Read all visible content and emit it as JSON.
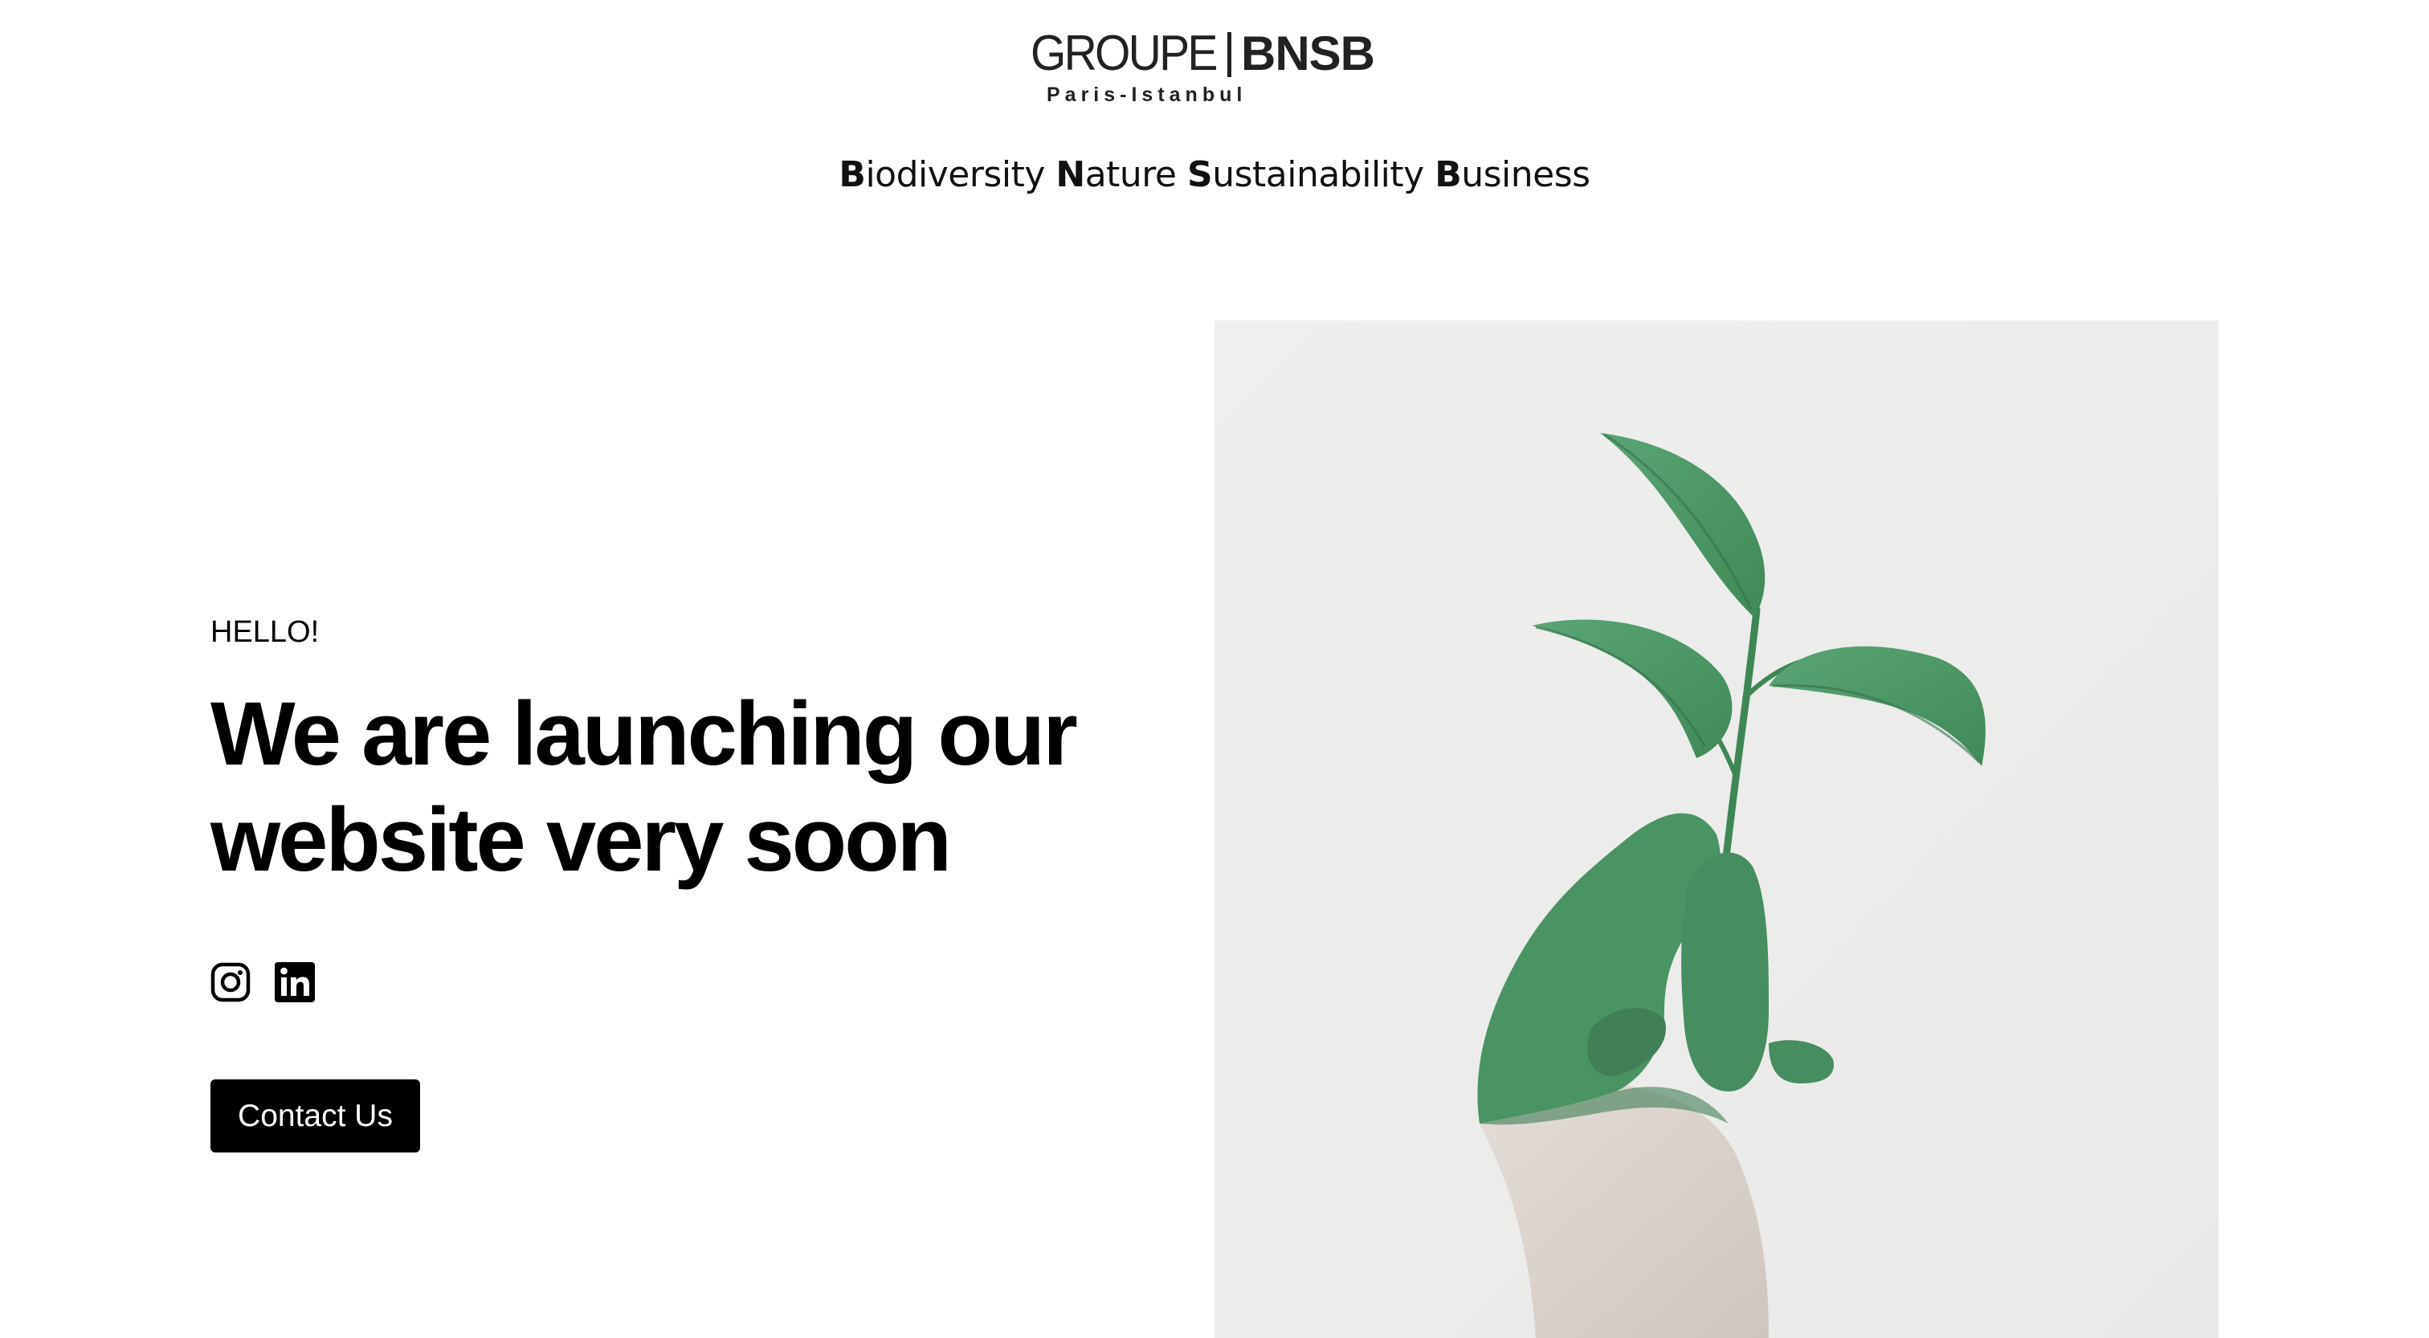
{
  "header": {
    "logo_light": "GROUPE",
    "logo_bold": "BNSB",
    "logo_sub": "Paris-Istanbul",
    "tagline": [
      {
        "initial": "B",
        "rest": "iodiversity"
      },
      {
        "initial": "N",
        "rest": "ature"
      },
      {
        "initial": "S",
        "rest": "ustainability"
      },
      {
        "initial": "B",
        "rest": "usiness"
      }
    ]
  },
  "main": {
    "greeting": "HELLO!",
    "headline_line1": "We are launching our",
    "headline_line2": "website very soon",
    "socials": [
      {
        "name": "instagram-icon"
      },
      {
        "name": "linkedin-icon"
      }
    ],
    "contact_label": "Contact Us"
  },
  "colors": {
    "accent": "#000000",
    "leaf_green": "#4a9363",
    "background": "#ffffff",
    "image_bg": "#ededed"
  }
}
